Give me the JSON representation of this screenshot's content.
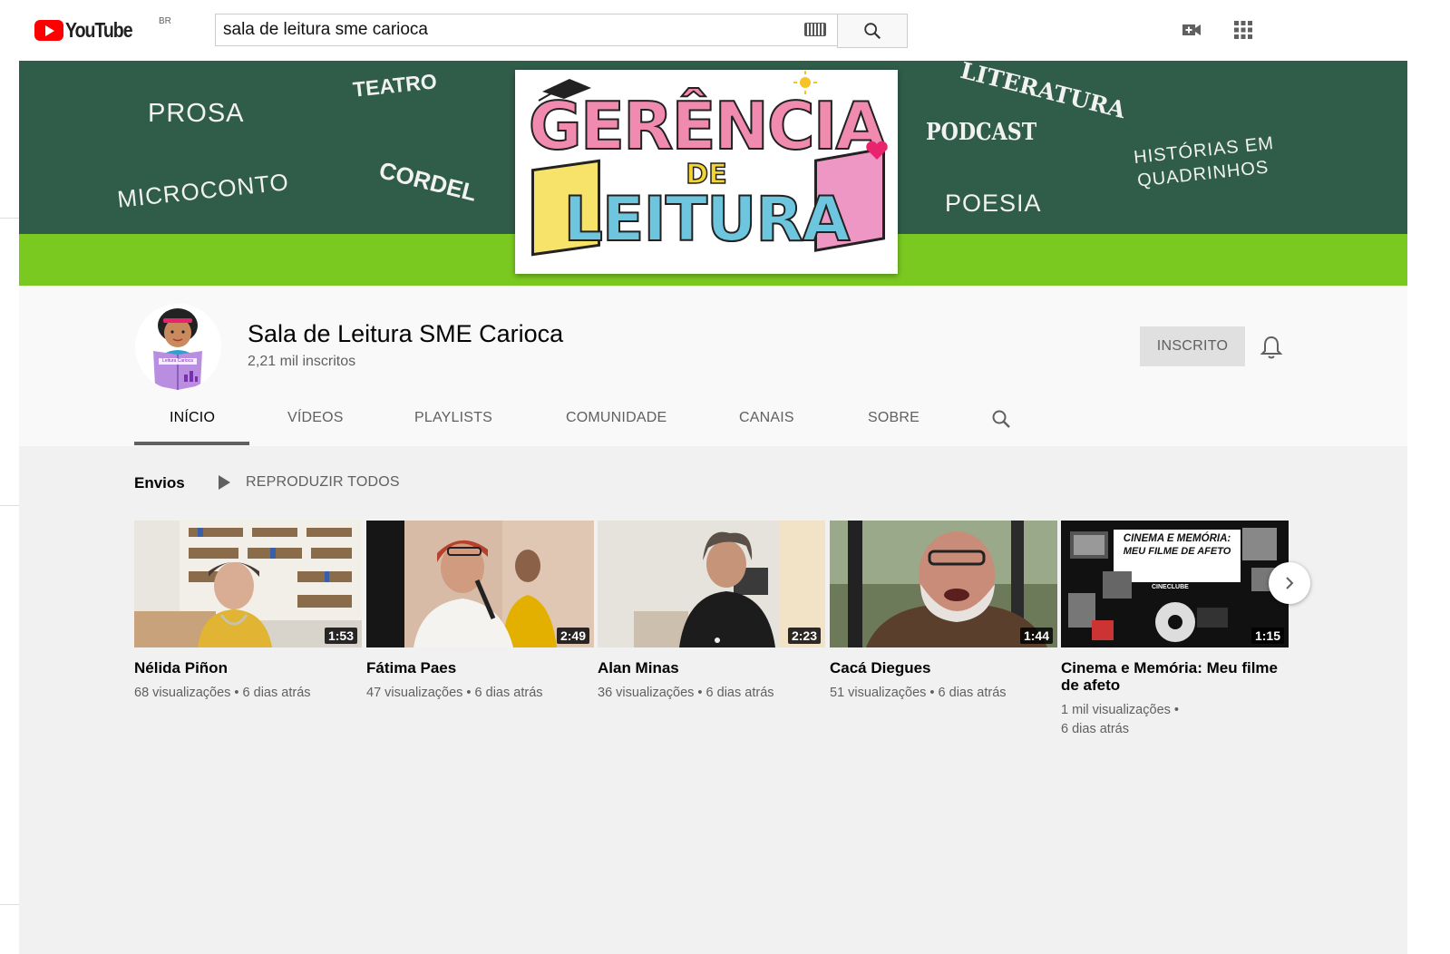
{
  "header": {
    "logo_text": "YouTube",
    "region": "BR",
    "search_value": "sala de leitura sme carioca",
    "icons": [
      "keyboard-icon",
      "search-icon",
      "video-camera-add-icon",
      "apps-grid-icon"
    ]
  },
  "banner": {
    "words": [
      "PROSA",
      "TEATRO",
      "MICROCONTO",
      "CORDEL",
      "LITERATURA",
      "PODCAST",
      "POESIA",
      "HISTÓRIAS EM",
      "QUADRINHOS"
    ],
    "card_line1": "GERÊNCIA",
    "card_line2": "DE",
    "card_line3": "LEITURA",
    "colors": {
      "dark": "#305c4a",
      "green": "#7ac920"
    }
  },
  "channel": {
    "name": "Sala de Leitura SME Carioca",
    "subscribers": "2,21 mil inscritos",
    "avatar_book_text": "Leitura Carioca",
    "subscribe_label": "INSCRITO"
  },
  "tabs": [
    {
      "label": "INÍCIO",
      "active": true
    },
    {
      "label": "VÍDEOS"
    },
    {
      "label": "PLAYLISTS"
    },
    {
      "label": "COMUNIDADE"
    },
    {
      "label": "CANAIS"
    },
    {
      "label": "SOBRE"
    }
  ],
  "section": {
    "title": "Envios",
    "play_all": "REPRODUZIR TODOS"
  },
  "videos": [
    {
      "title": "Nélida Piñon",
      "duration": "1:53",
      "views": "68 visualizações",
      "age": "6 dias atrás"
    },
    {
      "title": "Fátima Paes",
      "duration": "2:49",
      "views": "47 visualizações",
      "age": "6 dias atrás"
    },
    {
      "title": "Alan Minas",
      "duration": "2:23",
      "views": "36 visualizações",
      "age": "6 dias atrás"
    },
    {
      "title": "Cacá Diegues",
      "duration": "1:44",
      "views": "51 visualizações",
      "age": "6 dias atrás"
    },
    {
      "title": "Cinema e Memória: Meu filme de afeto",
      "duration": "1:15",
      "views": "1 mil visualizações •",
      "age": "6 dias atrás",
      "thumb_text": [
        "CINEMA E MEMÓRIA:",
        "MEU FILME DE AFETO",
        "CINECLUBE"
      ]
    }
  ]
}
